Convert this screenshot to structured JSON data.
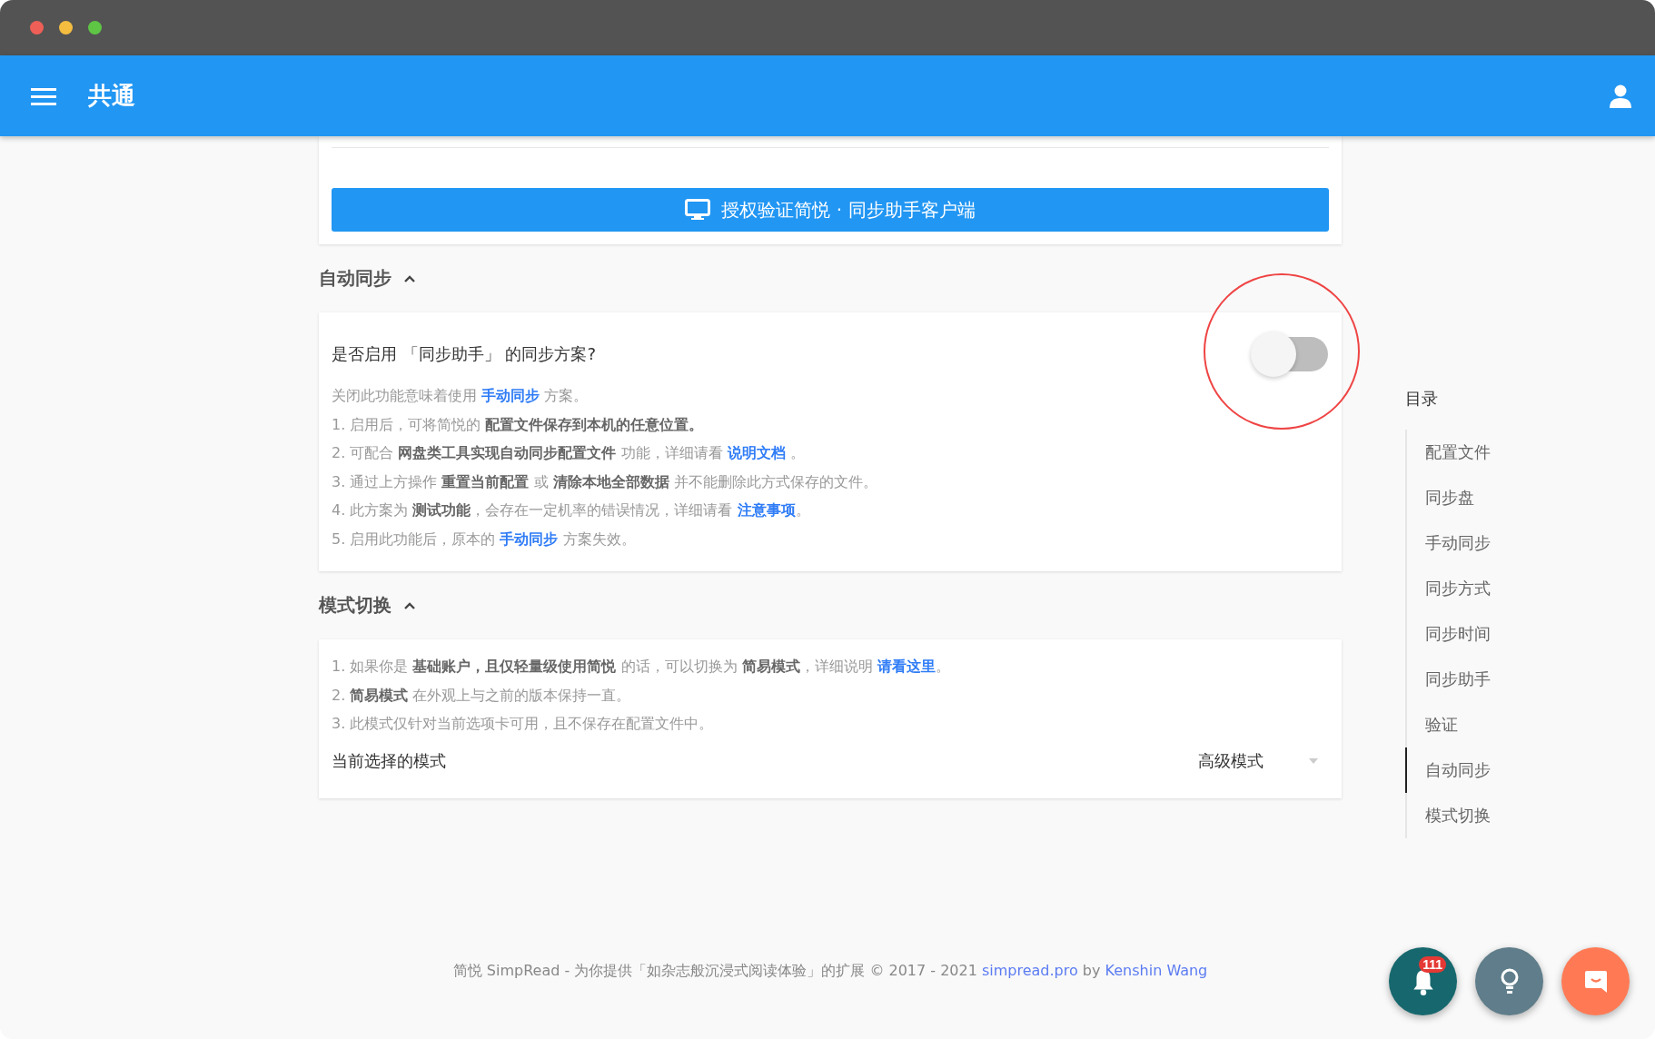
{
  "app_bar": {
    "title": "共通"
  },
  "auth_button": {
    "label": "授权验证简悦 · 同步助手客户端"
  },
  "sections": [
    {
      "title": "自动同步",
      "expanded": true,
      "question": "是否启用 「同步助手」 的同步方案?",
      "toggle": {
        "on": false,
        "highlighted": true
      },
      "lines": [
        [
          {
            "kind": "plain",
            "text": "关闭此功能意味着使用 "
          },
          {
            "kind": "link",
            "text": "手动同步"
          },
          {
            "kind": "plain",
            "text": " 方案。"
          }
        ],
        [
          {
            "kind": "plain",
            "text": "1. 启用后，可将简悦的 "
          },
          {
            "kind": "bold",
            "text": "配置文件保存到本机的任意位置。"
          }
        ],
        [
          {
            "kind": "plain",
            "text": "2. 可配合 "
          },
          {
            "kind": "bold",
            "text": "网盘类工具实现自动同步配置文件"
          },
          {
            "kind": "plain",
            "text": " 功能，详细请看 "
          },
          {
            "kind": "link",
            "text": "说明文档"
          },
          {
            "kind": "plain",
            "text": " 。"
          }
        ],
        [
          {
            "kind": "plain",
            "text": "3. 通过上方操作 "
          },
          {
            "kind": "bold",
            "text": "重置当前配置"
          },
          {
            "kind": "plain",
            "text": " 或 "
          },
          {
            "kind": "bold",
            "text": "清除本地全部数据"
          },
          {
            "kind": "plain",
            "text": " 并不能删除此方式保存的文件。"
          }
        ],
        [
          {
            "kind": "plain",
            "text": "4. 此方案为 "
          },
          {
            "kind": "bold",
            "text": "测试功能"
          },
          {
            "kind": "plain",
            "text": "，会存在一定机率的错误情况，详细请看 "
          },
          {
            "kind": "link",
            "text": "注意事项"
          },
          {
            "kind": "plain",
            "text": "。"
          }
        ],
        [
          {
            "kind": "plain",
            "text": "5. 启用此功能后，原本的 "
          },
          {
            "kind": "link",
            "text": "手动同步"
          },
          {
            "kind": "plain",
            "text": " 方案失效。"
          }
        ]
      ]
    },
    {
      "title": "模式切换",
      "expanded": true,
      "lines": [
        [
          {
            "kind": "plain",
            "text": "1. 如果你是 "
          },
          {
            "kind": "bold",
            "text": "基础账户，且仅轻量级使用简悦"
          },
          {
            "kind": "plain",
            "text": " 的话，可以切换为 "
          },
          {
            "kind": "bold",
            "text": "简易模式"
          },
          {
            "kind": "plain",
            "text": "，详细说明 "
          },
          {
            "kind": "link",
            "text": "请看这里"
          },
          {
            "kind": "plain",
            "text": "。"
          }
        ],
        [
          {
            "kind": "plain",
            "text": "2. "
          },
          {
            "kind": "bold",
            "text": "简易模式"
          },
          {
            "kind": "plain",
            "text": " 在外观上与之前的版本保持一直。"
          }
        ],
        [
          {
            "kind": "plain",
            "text": "3. 此模式仅针对当前选项卡可用，且不保存在配置文件中。"
          }
        ]
      ],
      "select": {
        "label": "当前选择的模式",
        "value": "高级模式"
      }
    }
  ],
  "toc": {
    "title": "目录",
    "items": [
      {
        "label": "配置文件",
        "selected": false
      },
      {
        "label": "同步盘",
        "selected": false
      },
      {
        "label": "手动同步",
        "selected": false
      },
      {
        "label": "同步方式",
        "selected": false
      },
      {
        "label": "同步时间",
        "selected": false
      },
      {
        "label": "同步助手",
        "selected": false
      },
      {
        "label": "验证",
        "selected": false
      },
      {
        "label": "自动同步",
        "selected": true
      },
      {
        "label": "模式切换",
        "selected": false
      }
    ]
  },
  "footer": [
    {
      "kind": "plain",
      "text": "简悦 SimpRead - 为你提供「如杂志般沉浸式阅读体验」的扩展 © 2017 - 2021 "
    },
    {
      "kind": "link",
      "text": "simpread.pro"
    },
    {
      "kind": "plain",
      "text": " by "
    },
    {
      "kind": "link",
      "text": "Kenshin Wang"
    }
  ],
  "fabs": [
    {
      "kind": "notifications",
      "badge": "111"
    },
    {
      "kind": "tips"
    },
    {
      "kind": "feedback"
    }
  ]
}
